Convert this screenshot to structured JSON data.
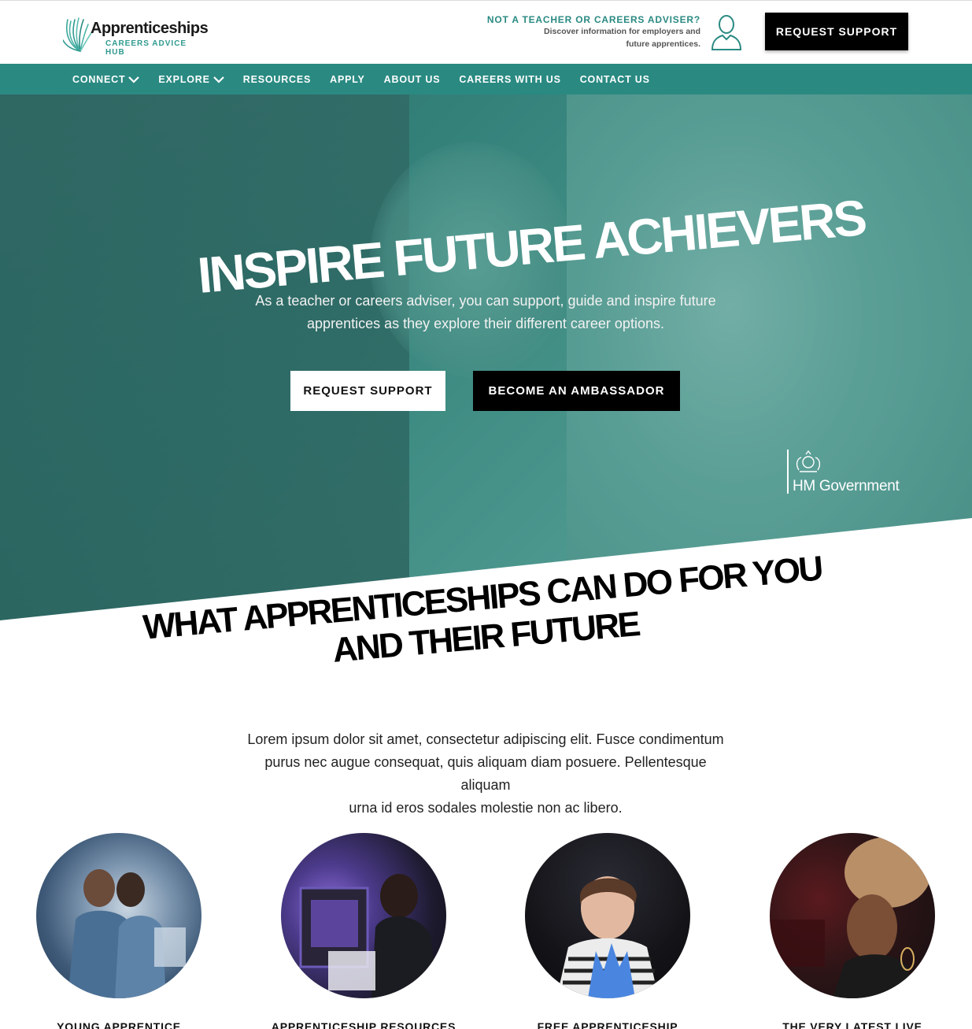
{
  "header": {
    "logo_title": "Apprenticeships",
    "logo_subtitle": "CAREERS ADVICE HUB",
    "not_teacher_question": "NOT A TEACHER OR CAREERS ADVISER?",
    "not_teacher_line1": "Discover information for employers and",
    "not_teacher_line2": "future apprentices.",
    "request_support_label": "REQUEST SUPPORT"
  },
  "nav": {
    "items": [
      {
        "label": "CONNECT",
        "has_dropdown": true
      },
      {
        "label": "EXPLORE",
        "has_dropdown": true
      },
      {
        "label": "RESOURCES",
        "has_dropdown": false
      },
      {
        "label": "APPLY",
        "has_dropdown": false
      },
      {
        "label": "ABOUT US",
        "has_dropdown": false
      },
      {
        "label": "CAREERS WITH US",
        "has_dropdown": false
      },
      {
        "label": "CONTACT US",
        "has_dropdown": false
      }
    ]
  },
  "hero": {
    "title": "INSPIRE FUTURE ACHIEVERS",
    "subtitle_line1": "As a teacher or careers adviser, you can support, guide and inspire future",
    "subtitle_line2": "apprentices as they explore their different career options.",
    "primary_button": "REQUEST SUPPORT",
    "secondary_button": "BECOME AN AMBASSADOR",
    "gov_label": "HM Government"
  },
  "section": {
    "title_line1": "WHAT APPRENTICESHIPS CAN DO FOR YOU",
    "title_line2": "AND THEIR FUTURE",
    "body_line1": "Lorem ipsum dolor sit amet, consectetur adipiscing elit. Fusce condimentum",
    "body_line2": "purus nec augue consequat, quis aliquam diam posuere. Pellentesque aliquam",
    "body_line3": "urna id eros sodales molestie non ac libero."
  },
  "cards": [
    {
      "label": "YOUNG APPRENTICE"
    },
    {
      "label": "APPRENTICESHIP RESOURCES"
    },
    {
      "label": "FREE APPRENTICESHIP"
    },
    {
      "label": "THE VERY LATEST LIVE"
    }
  ],
  "colors": {
    "brand_teal": "#2a8a82",
    "black": "#000000",
    "white": "#ffffff"
  }
}
